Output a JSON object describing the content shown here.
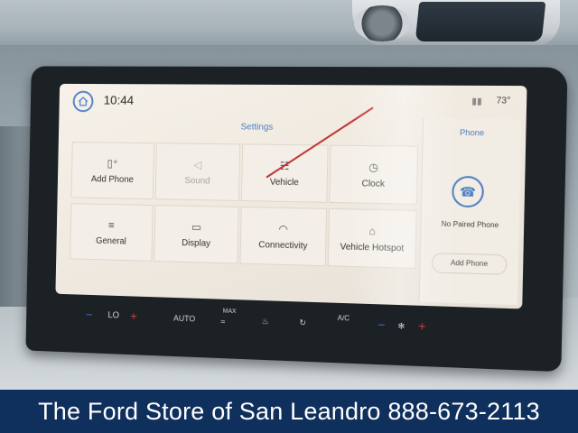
{
  "status": {
    "time": "10:44",
    "temperature": "73°",
    "signal_text": ""
  },
  "settings": {
    "title": "Settings",
    "tiles": [
      {
        "label": "Add Phone",
        "icon": "add-phone-icon"
      },
      {
        "label": "Sound",
        "icon": "speaker-icon"
      },
      {
        "label": "Vehicle",
        "icon": "vehicle-icon"
      },
      {
        "label": "Clock",
        "icon": "clock-icon"
      },
      {
        "label": "General",
        "icon": "sliders-icon"
      },
      {
        "label": "Display",
        "icon": "display-icon"
      },
      {
        "label": "Connectivity",
        "icon": "wifi-icon"
      },
      {
        "label": "Vehicle Hotspot",
        "icon": "hotspot-icon"
      }
    ]
  },
  "phone_panel": {
    "title": "Phone",
    "status": "No Paired Phone",
    "button": "Add Phone"
  },
  "climate": {
    "fan_label": "LO",
    "auto_label": "AUTO",
    "max_label": "MAX",
    "ac_label": "A/C"
  },
  "banner": {
    "text": "The Ford Store of San Leandro 888-673-2113"
  },
  "colors": {
    "accent": "#4f7fc6",
    "banner": "#0f2f5c",
    "annotation": "#c0312e"
  }
}
